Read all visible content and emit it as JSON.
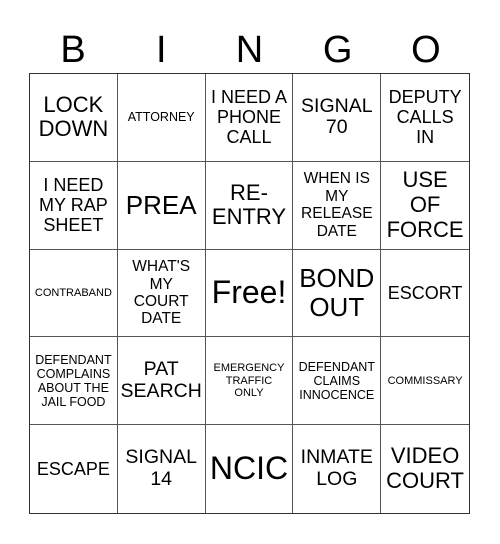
{
  "header": [
    "B",
    "I",
    "N",
    "G",
    "O"
  ],
  "cells": [
    "LOCK\nDOWN",
    "ATTORNEY",
    "I NEED A\nPHONE\nCALL",
    "SIGNAL\n70",
    "DEPUTY\nCALLS\nIN",
    "I NEED\nMY RAP\nSHEET",
    "PREA",
    "RE-\nENTRY",
    "WHEN IS\nMY\nRELEASE\nDATE",
    "USE\nOF\nFORCE",
    "CONTRABAND",
    "WHAT'S\nMY\nCOURT\nDATE",
    "Free!",
    "BOND\nOUT",
    "ESCORT",
    "DEFENDANT\nCOMPLAINS\nABOUT THE\nJAIL FOOD",
    "PAT\nSEARCH",
    "EMERGENCY\nTRAFFIC\nONLY",
    "DEFENDANT\nCLAIMS\nINNOCENCE",
    "COMMISSARY",
    "ESCAPE",
    "SIGNAL\n14",
    "NCIC",
    "INMATE\nLOG",
    "VIDEO\nCOURT"
  ]
}
